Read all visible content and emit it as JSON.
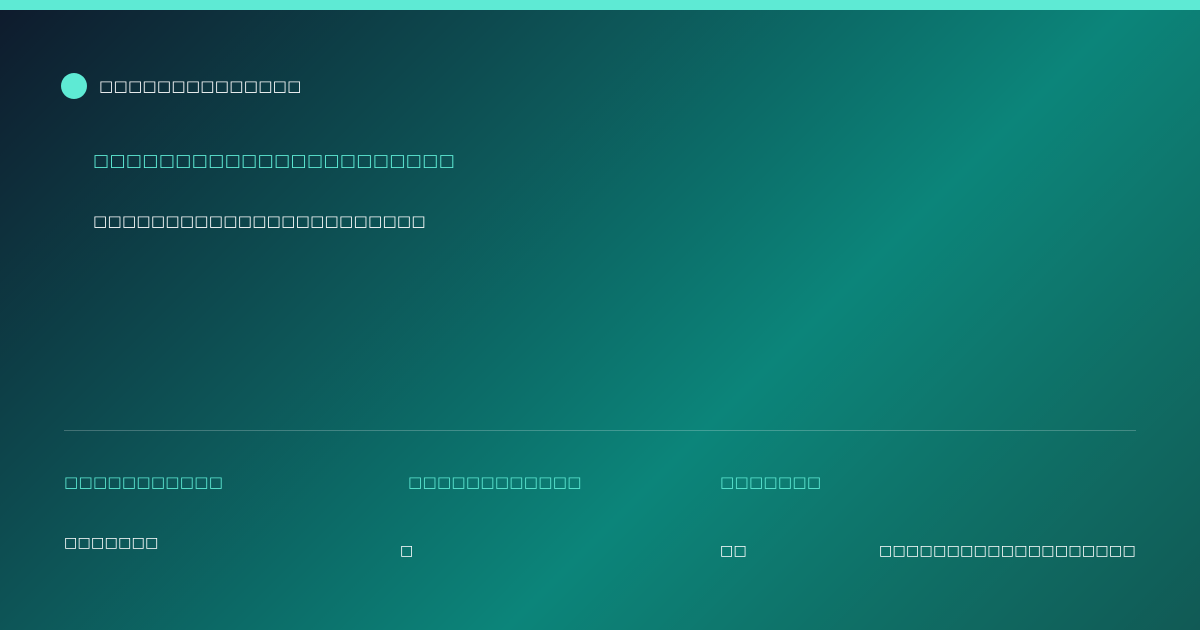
{
  "colors": {
    "accent": "#5eead4",
    "background_start": "#0e1a2c",
    "background_mid": "#0c857a",
    "background_end": "#115a55",
    "text": "#ffffff"
  },
  "brand": {
    "icon": "brand-dot-icon",
    "name": "□□□□□□□□□□□□□□"
  },
  "hero": {
    "headline": "□□□□□□□□□□□□□□□□□□□□□□",
    "subline": "□□□□□□□□□□□□□□□□□□□□□□□"
  },
  "stats": [
    {
      "label": "□□□□□□□□□□□",
      "value": "□□□□□□□"
    },
    {
      "label": "□□□□□□□□□□□□",
      "value": "□"
    },
    {
      "label": "□□□□□□□",
      "value": "□□"
    }
  ],
  "footer": {
    "note": "□□□□□□□□□□□□□□□□□□□"
  }
}
